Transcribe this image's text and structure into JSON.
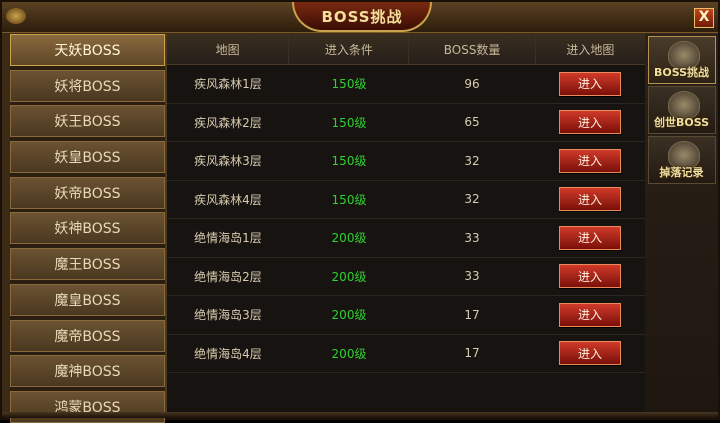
{
  "window": {
    "title": "BOSS挑战",
    "close_label": "X"
  },
  "sidebar": {
    "items": [
      {
        "label": "天妖BOSS",
        "active": true
      },
      {
        "label": "妖将BOSS",
        "active": false
      },
      {
        "label": "妖王BOSS",
        "active": false
      },
      {
        "label": "妖皇BOSS",
        "active": false
      },
      {
        "label": "妖帝BOSS",
        "active": false
      },
      {
        "label": "妖神BOSS",
        "active": false
      },
      {
        "label": "魔王BOSS",
        "active": false
      },
      {
        "label": "魔皇BOSS",
        "active": false
      },
      {
        "label": "魔帝BOSS",
        "active": false
      },
      {
        "label": "魔神BOSS",
        "active": false
      },
      {
        "label": "鸿蒙BOSS",
        "active": false
      }
    ]
  },
  "table": {
    "headers": [
      "地图",
      "进入条件",
      "BOSS数量",
      "进入地图"
    ],
    "rows": [
      {
        "map": "疾风森林1层",
        "req": "150级",
        "count": "96",
        "action": "进入"
      },
      {
        "map": "疾风森林2层",
        "req": "150级",
        "count": "65",
        "action": "进入"
      },
      {
        "map": "疾风森林3层",
        "req": "150级",
        "count": "32",
        "action": "进入"
      },
      {
        "map": "疾风森林4层",
        "req": "150级",
        "count": "32",
        "action": "进入"
      },
      {
        "map": "绝情海岛1层",
        "req": "200级",
        "count": "33",
        "action": "进入"
      },
      {
        "map": "绝情海岛2层",
        "req": "200级",
        "count": "33",
        "action": "进入"
      },
      {
        "map": "绝情海岛3层",
        "req": "200级",
        "count": "17",
        "action": "进入"
      },
      {
        "map": "绝情海岛4层",
        "req": "200级",
        "count": "17",
        "action": "进入"
      }
    ]
  },
  "righttabs": [
    {
      "label": "BOSS挑战",
      "icon": "demon-head-icon",
      "active": true
    },
    {
      "label": "创世BOSS",
      "icon": "dragon-head-icon",
      "active": false
    },
    {
      "label": "掉落记录",
      "icon": "scroll-icon",
      "active": false
    }
  ],
  "colors": {
    "requirement": "#2fd12f",
    "enter_button": "#b0261a",
    "frame_gold": "#c9a24a"
  }
}
